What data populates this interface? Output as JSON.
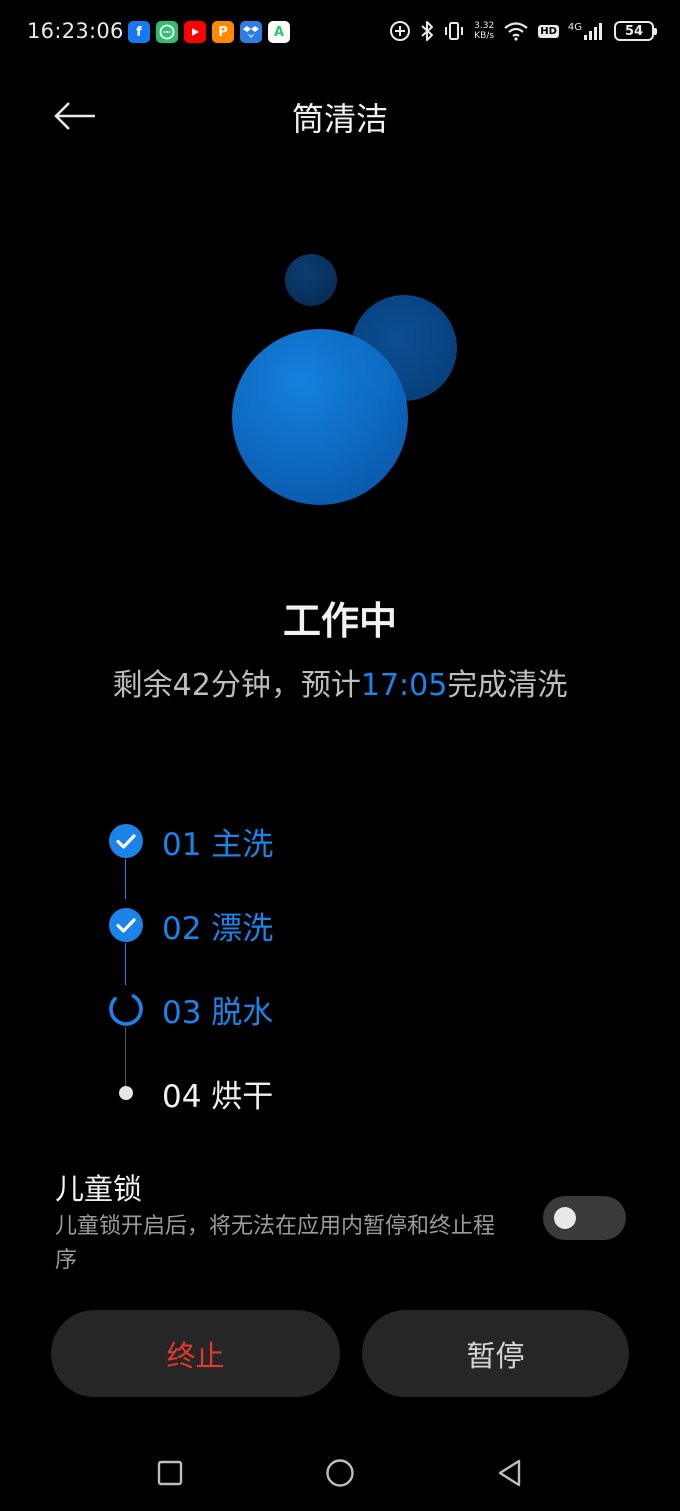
{
  "status_bar": {
    "time": "16:23:06",
    "app_icons": [
      {
        "name": "facebook-app-icon",
        "glyph": "f",
        "color": "#1877f2"
      },
      {
        "name": "messages-app-icon",
        "glyph": "…",
        "color": "#2fbf71"
      },
      {
        "name": "youtube-app-icon",
        "glyph": "▶",
        "color": "#ff0000"
      },
      {
        "name": "payment-app-icon",
        "glyph": "P",
        "color": "#ff8a00"
      },
      {
        "name": "dropbox-app-icon",
        "glyph": "◆",
        "color": "#2f7de1"
      },
      {
        "name": "store-app-icon",
        "glyph": "A",
        "color": "#32c66a"
      }
    ],
    "net_speed_value": "3.32",
    "net_speed_unit": "KB/s",
    "hd_label": "HD",
    "network_label": "4G",
    "battery_level": "54"
  },
  "header": {
    "title": "筒清洁"
  },
  "status": {
    "heading": "工作中",
    "remaining_prefix": "剩余42分钟，预计",
    "finish_time": "17:05",
    "remaining_suffix": "完成清洗"
  },
  "steps": [
    {
      "label": "01  主洗",
      "state": "done"
    },
    {
      "label": "02  漂洗",
      "state": "done"
    },
    {
      "label": "03  脱水",
      "state": "in-progress"
    },
    {
      "label": "04  烘干",
      "state": "pending"
    }
  ],
  "child_lock": {
    "title": "儿童锁",
    "description": "儿童锁开启后，将无法在应用内暂停和终止程序",
    "enabled": false
  },
  "actions": {
    "stop_label": "终止",
    "pause_label": "暂停"
  },
  "colors": {
    "accent": "#1a84e8",
    "danger": "#e0392f",
    "background": "#000000",
    "button_bg": "#262626"
  }
}
